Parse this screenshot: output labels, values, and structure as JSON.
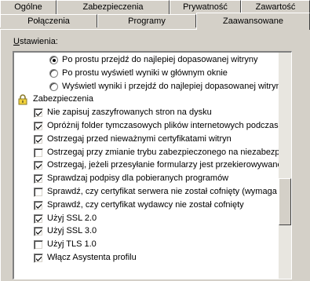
{
  "tabs_back": [
    "Ogólne",
    "Zabezpieczenia",
    "Prywatność",
    "Zawartość"
  ],
  "tabs_front": [
    "Połączenia",
    "Programy",
    "Zaawansowane"
  ],
  "active_tab": "Zaawansowane",
  "settings_label": "Ustawienia:",
  "settings_label_accel": "U",
  "settings_label_rest": "stawienia:",
  "items": [
    {
      "kind": "radio",
      "checked": true,
      "label": "Po prostu przejdź do najlepiej dopasowanej witryny"
    },
    {
      "kind": "radio",
      "checked": false,
      "label": "Po prostu wyświetl wyniki w głównym oknie"
    },
    {
      "kind": "radio",
      "checked": false,
      "label": "Wyświetl wyniki i przejdź do najlepiej dopasowanej witryny"
    },
    {
      "kind": "group",
      "icon": "lock-icon",
      "label": "Zabezpieczenia"
    },
    {
      "kind": "check",
      "checked": true,
      "label": "Nie zapisuj zaszyfrowanych stron na dysku"
    },
    {
      "kind": "check",
      "checked": true,
      "label": "Opróżnij folder tymczasowych plików internetowych podczas za"
    },
    {
      "kind": "check",
      "checked": true,
      "label": "Ostrzegaj przed nieważnymi certyfikatami witryn"
    },
    {
      "kind": "check",
      "checked": false,
      "label": "Ostrzegaj przy zmianie trybu zabezpieczonego na niezabezpiec"
    },
    {
      "kind": "check",
      "checked": true,
      "label": "Ostrzegaj, jeżeli przesyłanie formularzy jest przekierowywane"
    },
    {
      "kind": "check",
      "checked": true,
      "label": "Sprawdzaj podpisy dla pobieranych programów"
    },
    {
      "kind": "check",
      "checked": false,
      "label": "Sprawdź, czy certyfikat serwera nie został cofnięty (wymaga po"
    },
    {
      "kind": "check",
      "checked": true,
      "label": "Sprawdź, czy certyfikat wydawcy nie został cofnięty"
    },
    {
      "kind": "check",
      "checked": true,
      "label": "Użyj SSL 2.0"
    },
    {
      "kind": "check",
      "checked": true,
      "label": "Użyj SSL 3.0"
    },
    {
      "kind": "check",
      "checked": false,
      "label": "Użyj TLS 1.0"
    },
    {
      "kind": "check",
      "checked": true,
      "label": "Włącz Asystenta profilu"
    }
  ]
}
